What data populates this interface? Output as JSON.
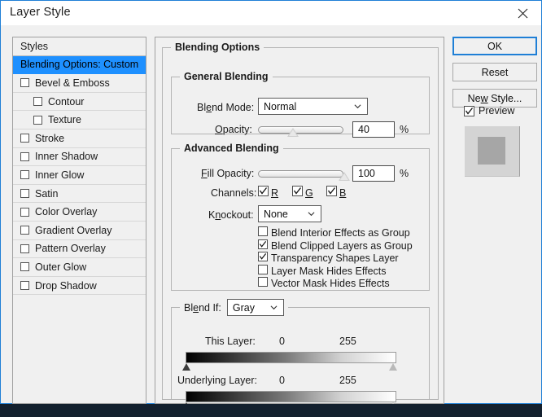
{
  "window": {
    "title": "Layer Style",
    "close_icon": "close-icon",
    "accent_color": "#1f7fd6",
    "face_color": "#f0f0f0"
  },
  "styles_panel": {
    "header": "Styles",
    "items": [
      {
        "label": "Blending Options: Custom",
        "selected": true,
        "checkbox": false,
        "indent": false
      },
      {
        "label": "Bevel & Emboss",
        "selected": false,
        "checkbox": true,
        "checked": false,
        "indent": false
      },
      {
        "label": "Contour",
        "selected": false,
        "checkbox": true,
        "checked": false,
        "indent": true
      },
      {
        "label": "Texture",
        "selected": false,
        "checkbox": true,
        "checked": false,
        "indent": true
      },
      {
        "label": "Stroke",
        "selected": false,
        "checkbox": true,
        "checked": false,
        "indent": false
      },
      {
        "label": "Inner Shadow",
        "selected": false,
        "checkbox": true,
        "checked": false,
        "indent": false
      },
      {
        "label": "Inner Glow",
        "selected": false,
        "checkbox": true,
        "checked": false,
        "indent": false
      },
      {
        "label": "Satin",
        "selected": false,
        "checkbox": true,
        "checked": false,
        "indent": false
      },
      {
        "label": "Color Overlay",
        "selected": false,
        "checkbox": true,
        "checked": false,
        "indent": false
      },
      {
        "label": "Gradient Overlay",
        "selected": false,
        "checkbox": true,
        "checked": false,
        "indent": false
      },
      {
        "label": "Pattern Overlay",
        "selected": false,
        "checkbox": true,
        "checked": false,
        "indent": false
      },
      {
        "label": "Outer Glow",
        "selected": false,
        "checkbox": true,
        "checked": false,
        "indent": false
      },
      {
        "label": "Drop Shadow",
        "selected": false,
        "checkbox": true,
        "checked": false,
        "indent": false
      }
    ]
  },
  "blending_options": {
    "group_title": "Blending Options",
    "general": {
      "group_title": "General Blending",
      "blend_mode_label": "Blend Mode:",
      "blend_mode_value": "Normal",
      "opacity_label": "Opacity:",
      "opacity_value": "40",
      "opacity_percent": "%",
      "opacity_slider_pct": 40
    },
    "advanced": {
      "group_title": "Advanced Blending",
      "fill_opacity_label": "Fill Opacity:",
      "fill_opacity_value": "100",
      "fill_opacity_percent": "%",
      "fill_opacity_slider_pct": 100,
      "channels_label": "Channels:",
      "channels": [
        {
          "label": "R",
          "checked": true
        },
        {
          "label": "G",
          "checked": true
        },
        {
          "label": "B",
          "checked": true
        }
      ],
      "knockout_label": "Knockout:",
      "knockout_value": "None",
      "options": [
        {
          "label": "Blend Interior Effects as Group",
          "checked": false
        },
        {
          "label": "Blend Clipped Layers as Group",
          "checked": true
        },
        {
          "label": "Transparency Shapes Layer",
          "checked": true
        },
        {
          "label": "Layer Mask Hides Effects",
          "checked": false
        },
        {
          "label": "Vector Mask Hides Effects",
          "checked": false
        }
      ]
    },
    "blend_if": {
      "label": "Blend If:",
      "value": "Gray",
      "this_layer_label": "This Layer:",
      "this_layer_min": "0",
      "this_layer_max": "255",
      "underlying_layer_label": "Underlying Layer:",
      "underlying_layer_min": "0",
      "underlying_layer_max": "255"
    }
  },
  "buttons": {
    "ok": "OK",
    "reset": "Reset",
    "new_style": "New Style...",
    "preview_label": "Preview",
    "preview_checked": true
  }
}
